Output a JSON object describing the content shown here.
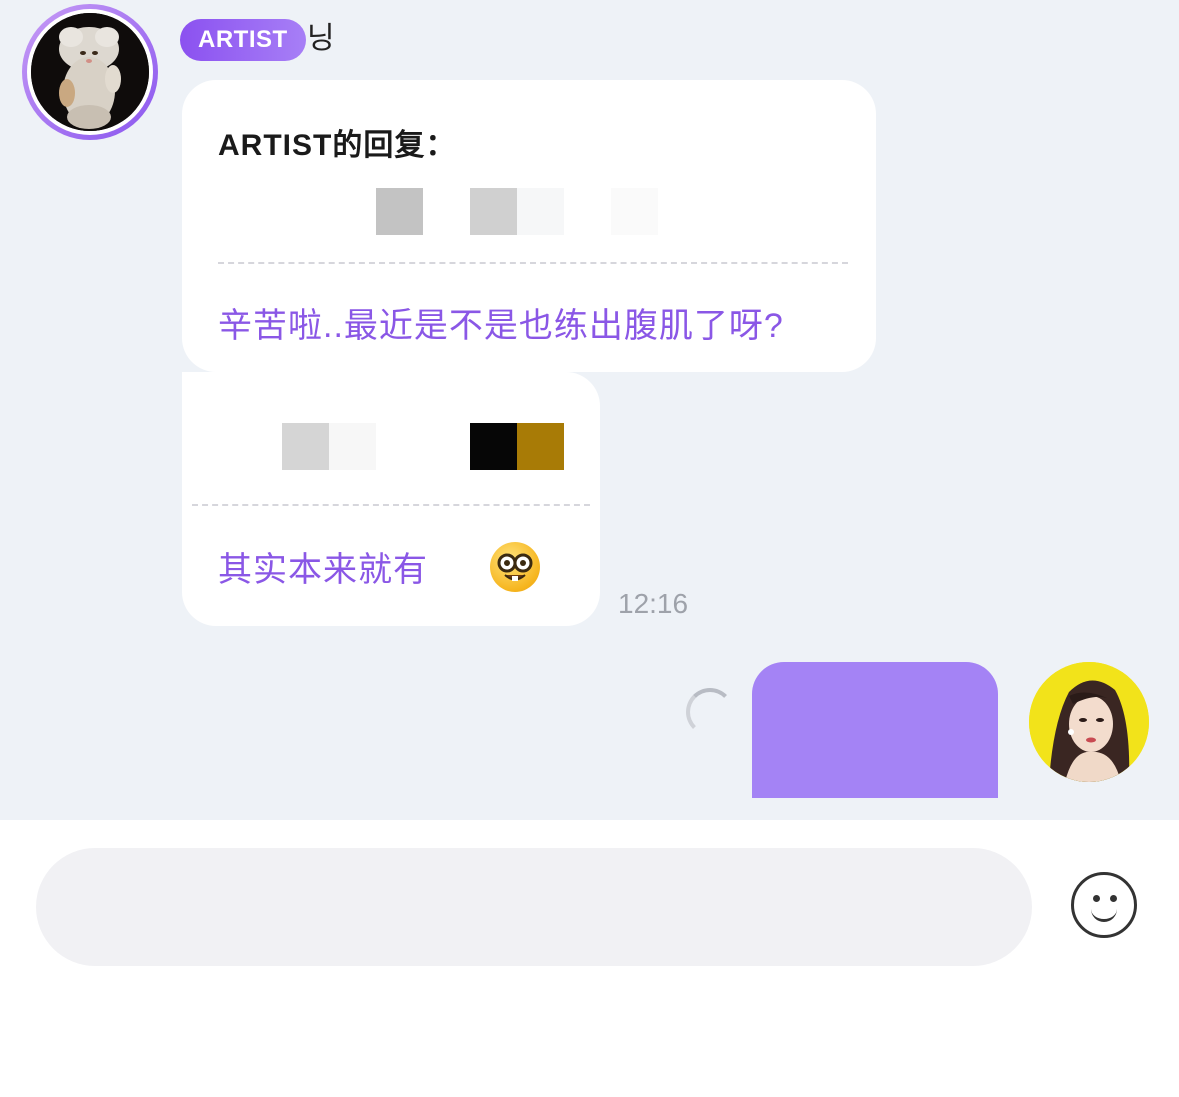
{
  "artist": {
    "badge": "ARTIST",
    "name": "닝"
  },
  "messages": [
    {
      "reply_title": "ARTIST的回复：",
      "reply_text": "辛苦啦..最近是不是也练出腹肌了呀?"
    },
    {
      "reply_text": "其实本来就有",
      "emoji": "nerd-face-emoji"
    }
  ],
  "timestamp": "12:16",
  "sent": {
    "status": "sending",
    "bubble_color": "#a483f5"
  },
  "input": {
    "placeholder": "",
    "value": ""
  },
  "colors": {
    "accent": "#8a57e6",
    "badge": "#8b51f0",
    "chat_background": "#eef2f7"
  },
  "icons": {
    "emoji_button": "smiley-icon"
  }
}
